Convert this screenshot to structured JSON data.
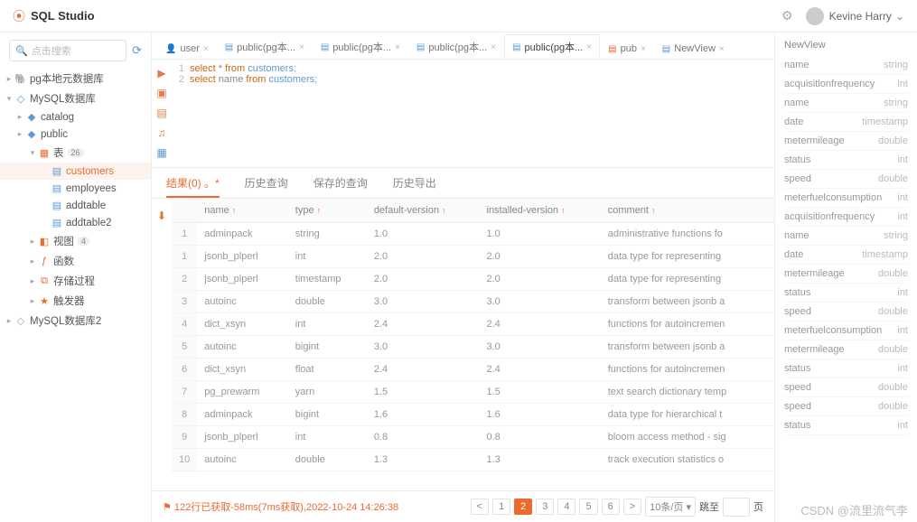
{
  "header": {
    "app": "SQL Studio",
    "user": "Kevine Harry"
  },
  "search": {
    "placeholder": "点击搜索"
  },
  "tree": [
    {
      "d": 0,
      "tgl": "▸",
      "ic": "🐘",
      "iccolor": "#5b9bd5",
      "label": "pg本地元数据库"
    },
    {
      "d": 0,
      "tgl": "▾",
      "ic": "◇",
      "iccolor": "#5b9bd5",
      "label": "MySQL数据库"
    },
    {
      "d": 1,
      "tgl": "▸",
      "ic": "◆",
      "iccolor": "#5b9bd5",
      "label": "catalog"
    },
    {
      "d": 1,
      "tgl": "▸",
      "ic": "◆",
      "iccolor": "#5b9bd5",
      "label": "public"
    },
    {
      "d": 2,
      "tgl": "▾",
      "ic": "▦",
      "iccolor": "#ec6a2d",
      "label": "表",
      "badge": "26"
    },
    {
      "d": 3,
      "tgl": "",
      "ic": "▤",
      "iccolor": "#5b9bd5",
      "label": "customers",
      "sel": true
    },
    {
      "d": 3,
      "tgl": "",
      "ic": "▤",
      "iccolor": "#5b9bd5",
      "label": "employees"
    },
    {
      "d": 3,
      "tgl": "",
      "ic": "▤",
      "iccolor": "#5b9bd5",
      "label": "addtable"
    },
    {
      "d": 3,
      "tgl": "",
      "ic": "▤",
      "iccolor": "#5b9bd5",
      "label": "addtable2"
    },
    {
      "d": 2,
      "tgl": "▸",
      "ic": "◧",
      "iccolor": "#ec6a2d",
      "label": "视图",
      "badge": "4"
    },
    {
      "d": 2,
      "tgl": "▸",
      "ic": "ƒ",
      "iccolor": "#ec6a2d",
      "label": "函数"
    },
    {
      "d": 2,
      "tgl": "▸",
      "ic": "⧉",
      "iccolor": "#ec6a2d",
      "label": "存储过程"
    },
    {
      "d": 2,
      "tgl": "▸",
      "ic": "★",
      "iccolor": "#ec6a2d",
      "label": "触发器"
    },
    {
      "d": 0,
      "tgl": "▸",
      "ic": "◇",
      "iccolor": "#aaa",
      "label": "MySQL数据库2"
    }
  ],
  "tabs": [
    {
      "ic": "👤",
      "c": "#ec6a2d",
      "label": "user"
    },
    {
      "ic": "▤",
      "c": "#5b9bd5",
      "label": "public(pg本..."
    },
    {
      "ic": "▤",
      "c": "#5b9bd5",
      "label": "public(pg本..."
    },
    {
      "ic": "▤",
      "c": "#5b9bd5",
      "label": "public(pg本..."
    },
    {
      "ic": "▤",
      "c": "#5b9bd5",
      "label": "public(pg本...",
      "act": true
    },
    {
      "ic": "▤",
      "c": "#ec6a2d",
      "label": "pub"
    },
    {
      "ic": "▤",
      "c": "#5b9bd5",
      "label": "NewView"
    }
  ],
  "sql": {
    "line1": {
      "a": "select",
      "b": " * ",
      "c": "from",
      "d": " customers;"
    },
    "line2": {
      "a": "select",
      "b": " name ",
      "c": "from",
      "d": " customers;"
    },
    "ln1": "1",
    "ln2": "2"
  },
  "resultTabs": {
    "t1": "结果(0) 。*",
    "t2": "历史查询",
    "t3": "保存的查询",
    "t4": "历史导出"
  },
  "cols": {
    "c1": "name",
    "c2": "type",
    "c3": "default-version",
    "c4": "installed-version",
    "c5": "comment"
  },
  "rows": [
    {
      "n": "1",
      "name": "adminpack",
      "type": "string",
      "dv": "1.0",
      "iv": "1.0",
      "cm": "administrative functions fo"
    },
    {
      "n": "1",
      "name": "jsonb_plperl",
      "type": "int",
      "dv": "2.0",
      "iv": "2.0",
      "cm": "data type for representing"
    },
    {
      "n": "2",
      "name": "jsonb_plperl",
      "type": "timestamp",
      "dv": "2.0",
      "iv": "2.0",
      "cm": "data type for representing"
    },
    {
      "n": "3",
      "name": "autoinc",
      "type": "double",
      "dv": "3.0",
      "iv": "3.0",
      "cm": "transform between jsonb a"
    },
    {
      "n": "4",
      "name": "dict_xsyn",
      "type": "int",
      "dv": "2.4",
      "iv": "2.4",
      "cm": "functions for autoincremen"
    },
    {
      "n": "5",
      "name": "autoinc",
      "type": "bigint",
      "dv": "3.0",
      "iv": "3.0",
      "cm": "transform between jsonb a"
    },
    {
      "n": "6",
      "name": "dict_xsyn",
      "type": "float",
      "dv": "2.4",
      "iv": "2.4",
      "cm": "functions for autoincremen"
    },
    {
      "n": "7",
      "name": "pg_prewarm",
      "type": "yarn",
      "dv": "1.5",
      "iv": "1.5",
      "cm": "text search dictionary temp"
    },
    {
      "n": "8",
      "name": "adminpack",
      "type": "bigint",
      "dv": "1.6",
      "iv": "1.6",
      "cm": "data type for hierarchical t"
    },
    {
      "n": "9",
      "name": "jsonb_plperl",
      "type": "int",
      "dv": "0.8",
      "iv": "0.8",
      "cm": "bloom access method - sig"
    },
    {
      "n": "10",
      "name": "autoinc",
      "type": "double",
      "dv": "1.3",
      "iv": "1.3",
      "cm": "track execution statistics o"
    }
  ],
  "pager": {
    "status": "122行已获取-58ms(7ms获取),2022-10-24 14:26:38",
    "pages": [
      "1",
      "2",
      "3",
      "4",
      "5",
      "6"
    ],
    "perpage": "10条/页",
    "jump": "跳至",
    "jumppage": "页"
  },
  "rside": {
    "title": "NewView",
    "items": [
      {
        "k": "name",
        "v": "string"
      },
      {
        "k": "acquisitionfrequency",
        "v": "int"
      },
      {
        "k": "name",
        "v": "string"
      },
      {
        "k": "date",
        "v": "timestamp"
      },
      {
        "k": "metermileage",
        "v": "double"
      },
      {
        "k": "status",
        "v": "int"
      },
      {
        "k": "speed",
        "v": "double"
      },
      {
        "k": "meterfuelconsumption",
        "v": "int"
      },
      {
        "k": "acquisitionfrequency",
        "v": "int"
      },
      {
        "k": "name",
        "v": "string"
      },
      {
        "k": "date",
        "v": "timestamp"
      },
      {
        "k": "metermileage",
        "v": "double"
      },
      {
        "k": "status",
        "v": "int"
      },
      {
        "k": "speed",
        "v": "double"
      },
      {
        "k": "meterfuelconsumption",
        "v": "int"
      },
      {
        "k": "metermileage",
        "v": "double"
      },
      {
        "k": "status",
        "v": "int"
      },
      {
        "k": "speed",
        "v": "double"
      },
      {
        "k": "speed",
        "v": "double"
      },
      {
        "k": "status",
        "v": "int"
      }
    ]
  },
  "watermark": "CSDN @流里流气李"
}
